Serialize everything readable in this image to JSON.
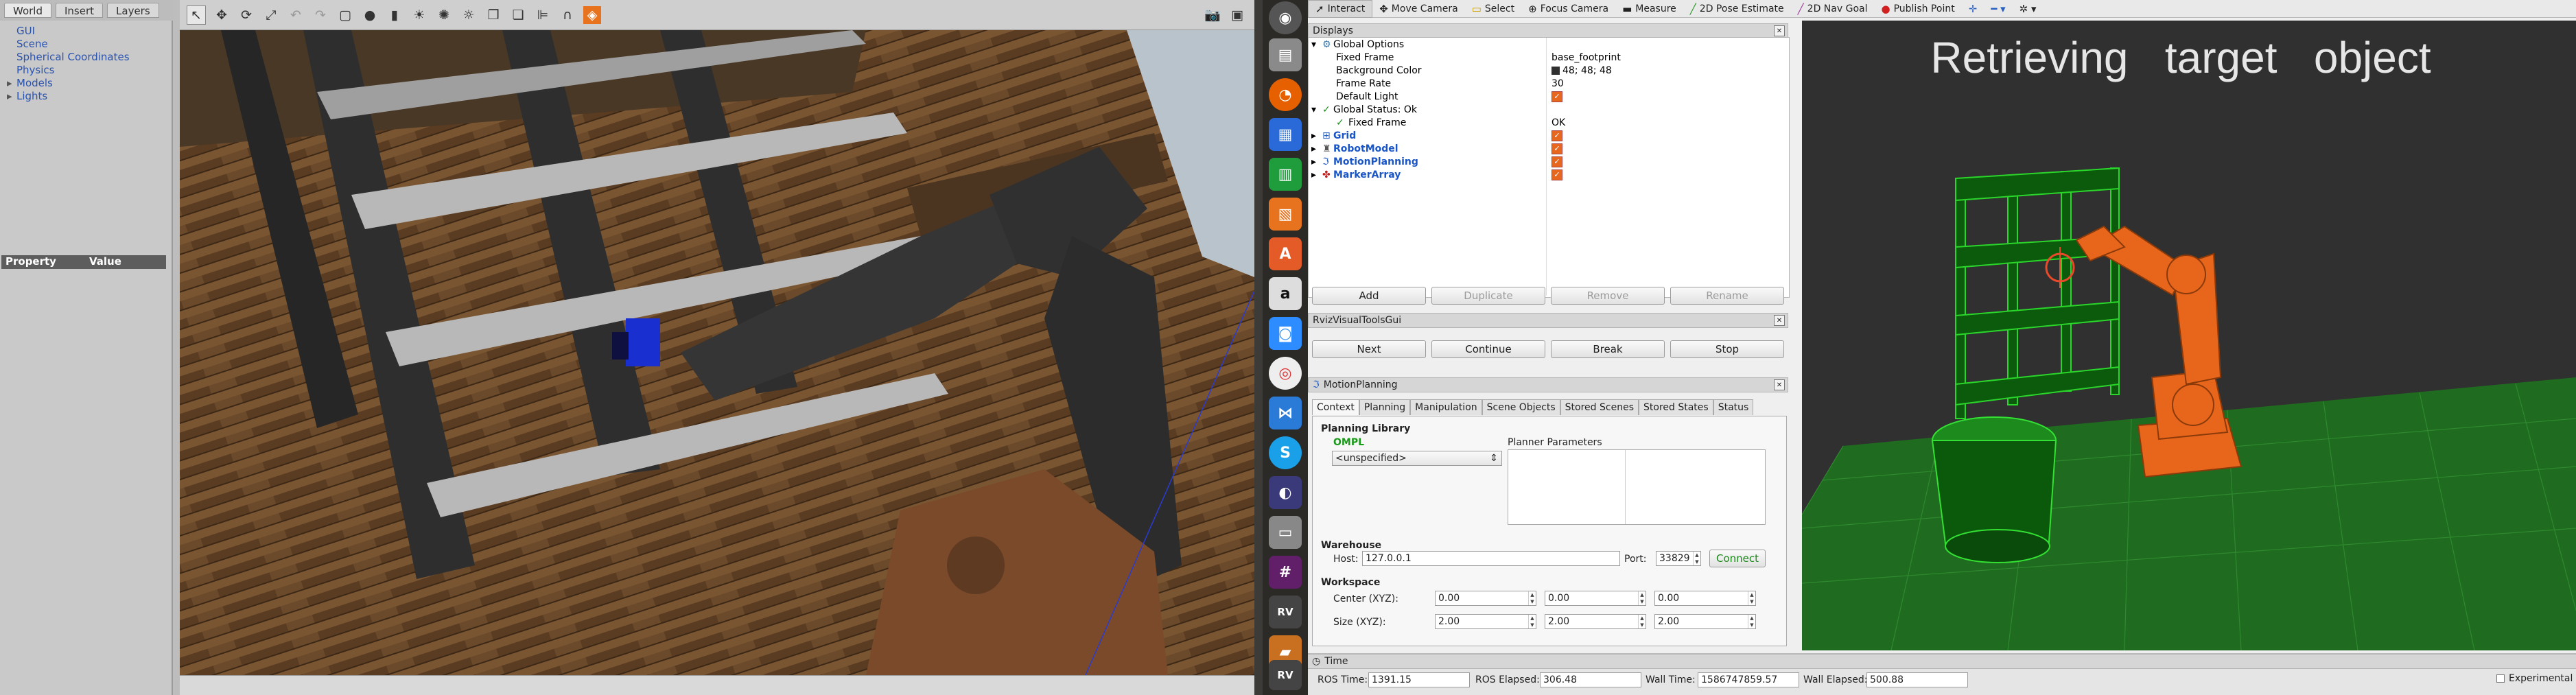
{
  "gazebo": {
    "tabs": [
      "World",
      "Insert",
      "Layers"
    ],
    "tree": [
      {
        "label": "GUI",
        "expandable": false
      },
      {
        "label": "Scene",
        "expandable": false
      },
      {
        "label": "Spherical Coordinates",
        "expandable": false
      },
      {
        "label": "Physics",
        "expandable": false
      },
      {
        "label": "Models",
        "expandable": true
      },
      {
        "label": "Lights",
        "expandable": true
      }
    ],
    "property_header": {
      "property": "Property",
      "value": "Value"
    }
  },
  "rviz": {
    "toolbar": [
      {
        "label": "Interact",
        "icon": "cursor-icon"
      },
      {
        "label": "Move Camera",
        "icon": "camera-icon"
      },
      {
        "label": "Select",
        "icon": "select-icon"
      },
      {
        "label": "Focus Camera",
        "icon": "focus-icon"
      },
      {
        "label": "Measure",
        "icon": "measure-icon"
      },
      {
        "label": "2D Pose Estimate",
        "icon": "pose-icon"
      },
      {
        "label": "2D Nav Goal",
        "icon": "nav-icon"
      },
      {
        "label": "Publish Point",
        "icon": "point-icon"
      }
    ],
    "displays": {
      "title": "Displays",
      "global_options": "Global Options",
      "fixed_frame_label": "Fixed Frame",
      "fixed_frame_value": "base_footprint",
      "background_color_label": "Background Color",
      "background_color_value": "48; 48; 48",
      "frame_rate_label": "Frame Rate",
      "frame_rate_value": "30",
      "default_light_label": "Default Light",
      "global_status": "Global Status: Ok",
      "fixed_frame_status_label": "Fixed Frame",
      "fixed_frame_status_value": "OK",
      "items": [
        "Grid",
        "RobotModel",
        "MotionPlanning",
        "MarkerArray"
      ],
      "buttons": [
        "Add",
        "Duplicate",
        "Remove",
        "Rename"
      ]
    },
    "visual_tools": {
      "title": "RvizVisualToolsGui",
      "buttons": [
        "Next",
        "Continue",
        "Break",
        "Stop"
      ]
    },
    "motion_planning": {
      "title": "MotionPlanning",
      "tabs": [
        "Context",
        "Planning",
        "Manipulation",
        "Scene Objects",
        "Stored Scenes",
        "Stored States",
        "Status"
      ],
      "planning_library_label": "Planning Library",
      "library": "OMPL",
      "planner_select": "<unspecified>",
      "planner_parameters_label": "Planner Parameters",
      "warehouse_label": "Warehouse",
      "host_label": "Host:",
      "host_value": "127.0.0.1",
      "port_label": "Port:",
      "port_value": "33829",
      "connect_label": "Connect",
      "workspace_label": "Workspace",
      "center_label": "Center (XYZ):",
      "center_values": [
        "0.00",
        "0.00",
        "0.00"
      ],
      "size_label": "Size (XYZ):",
      "size_values": [
        "2.00",
        "2.00",
        "2.00"
      ]
    },
    "overlay_text": "Retrieving   target   object",
    "time": {
      "title": "Time",
      "ros_time_label": "ROS Time:",
      "ros_time_value": "1391.15",
      "ros_elapsed_label": "ROS Elapsed:",
      "ros_elapsed_value": "306.48",
      "wall_time_label": "Wall Time:",
      "wall_time_value": "1586747859.57",
      "wall_elapsed_label": "Wall Elapsed:",
      "wall_elapsed_value": "500.88",
      "experimental_label": "Experimental"
    }
  },
  "colors": {
    "rviz_background": "#303030",
    "grid_green": "#1f6b1f",
    "robot_orange": "#e8661c",
    "shelf_green": "#22c022"
  }
}
